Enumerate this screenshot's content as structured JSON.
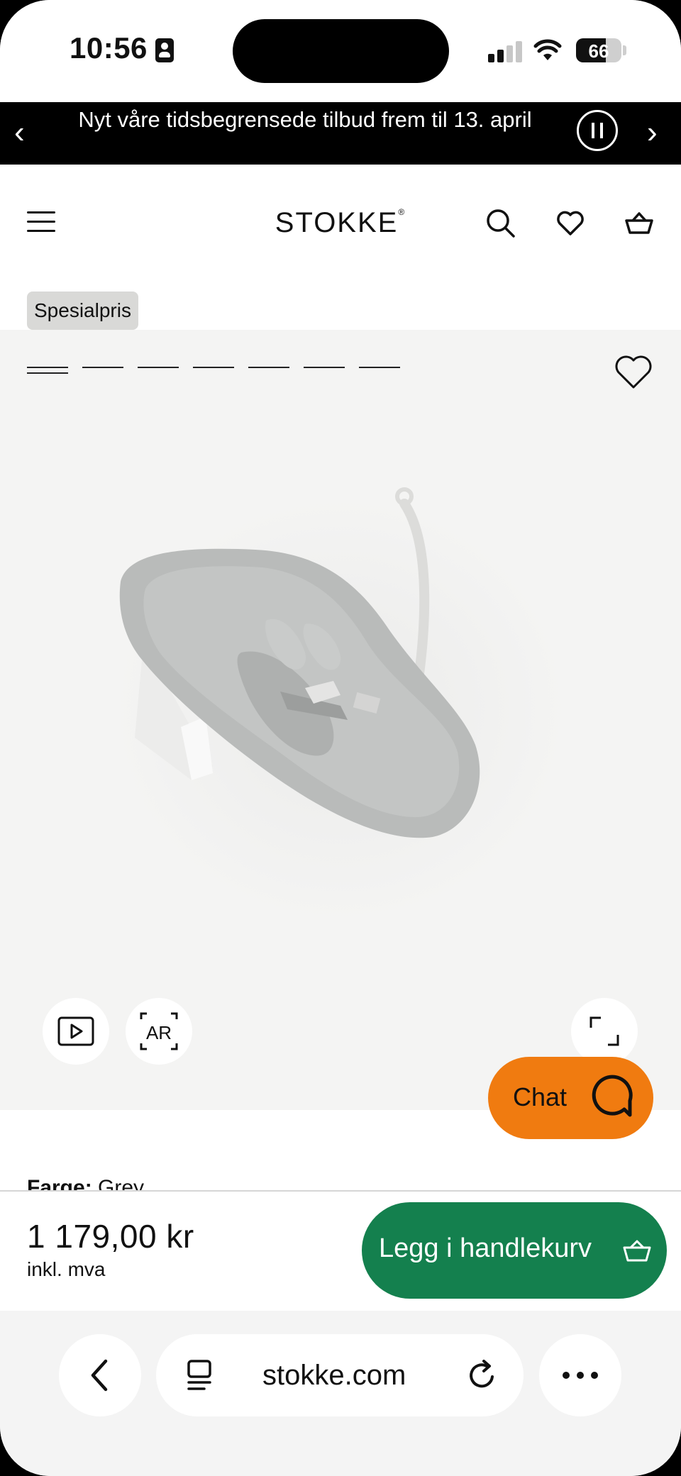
{
  "status_bar": {
    "time": "10:56",
    "battery_level": "66",
    "battery_fraction": 0.66
  },
  "promo": {
    "prev_arrow": "‹",
    "text": "Nyt våre tidsbegrensede tilbud frem til 13. april",
    "next_arrow": "›"
  },
  "header": {
    "logo": "STOKKE",
    "logo_mark": "®",
    "icons": [
      "menu-icon",
      "search-icon",
      "heart-icon",
      "basket-icon"
    ]
  },
  "product": {
    "badge": "Spesialpris",
    "gallery_image_count": 7,
    "gallery_active_index": 0,
    "ar_label": "AR",
    "color_label": "Farge:",
    "color_value": "Grey"
  },
  "chat": {
    "label": "Chat"
  },
  "purchase": {
    "price": "1 179,00 kr",
    "vat_note": "inkl. mva",
    "add_to_cart": "Legg i handlekurv"
  },
  "browser": {
    "url": "stokke.com"
  },
  "colors": {
    "promo_bg": "#000000",
    "badge_bg": "#d9d9d7",
    "chat_orange": "#f07b10",
    "cart_green": "#14804e",
    "gallery_bg": "#f4f4f3"
  }
}
